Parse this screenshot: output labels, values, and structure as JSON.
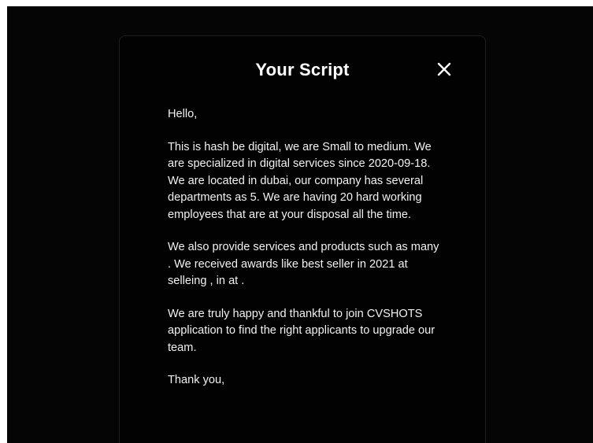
{
  "modal": {
    "title": "Your Script",
    "close_icon": "close-icon",
    "paragraphs": [
      "Hello,",
      "This is hash be digital, we are Small to medium. We are specialized in digital services since 2020-09-18. We are located in dubai, our company has several departments as 5. We are having 20 hard working employees that are at your disposal all the time.",
      "We also provide services and products such as many . We received awards like best seller in 2021 at selleing , in at .",
      "We are truly happy and thankful to join CVSHOTS application to find the right applicants to upgrade our team.",
      "Thank you,"
    ]
  },
  "colors": {
    "backdrop": "#050505",
    "modal_background": "#020202",
    "text": "#f2f2f2",
    "title": "#ffffff"
  }
}
